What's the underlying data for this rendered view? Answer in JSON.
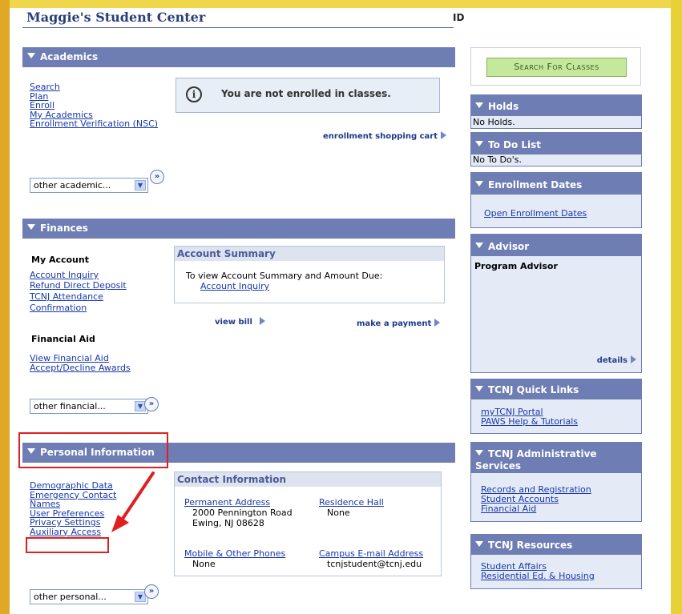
{
  "header": {
    "title": "Maggie's Student Center",
    "id_label": "ID"
  },
  "academics": {
    "header": "Academics",
    "links": [
      "Search",
      "Plan",
      "Enroll",
      "My Academics",
      "Enrollment Verification (NSC)"
    ],
    "notice": "You are not enrolled in classes.",
    "shopping_cart": "enrollment shopping cart",
    "dropdown": "other academic..."
  },
  "finances": {
    "header": "Finances",
    "my_account_heading": "My Account",
    "account_links": [
      "Account Inquiry",
      "Refund Direct Deposit",
      "TCNJ Attendance",
      "Confirmation"
    ],
    "financial_aid_heading": "Financial Aid",
    "aid_links": [
      "View Financial Aid",
      "Accept/Decline Awards"
    ],
    "summary_title": "Account Summary",
    "summary_text": "To view Account Summary and Amount Due:",
    "summary_link": "Account Inquiry",
    "view_bill": "view bill",
    "make_payment": "make a payment",
    "dropdown": "other financial..."
  },
  "personal": {
    "header": "Personal Information",
    "links": [
      "Demographic Data",
      "Emergency Contact",
      "Names",
      "User Preferences",
      "Privacy Settings",
      "Auxiliary Access"
    ],
    "contact_title": "Contact Information",
    "permanent_address_label": "Permanent Address",
    "address_line1": "2000 Pennington Road",
    "address_line2": "Ewing, NJ 08628",
    "residence_hall_label": "Residence Hall",
    "residence_hall_value": "None",
    "phones_label": "Mobile & Other Phones",
    "phones_value": "None",
    "email_label": "Campus E-mail Address",
    "email_value": "tcnjstudent@tcnj.edu",
    "dropdown": "other personal..."
  },
  "sidebar": {
    "search_button": "Search For Classes",
    "holds": {
      "header": "Holds",
      "text": "No Holds."
    },
    "todo": {
      "header": "To Do List",
      "text": "No To Do's."
    },
    "enrollment_dates": {
      "header": "Enrollment Dates",
      "link": "Open Enrollment Dates"
    },
    "advisor": {
      "header": "Advisor",
      "label": "Program Advisor",
      "details": "details"
    },
    "quick_links": {
      "header": "TCNJ Quick Links",
      "links": [
        "myTCNJ Portal",
        "PAWS Help & Tutorials"
      ]
    },
    "admin_services": {
      "header": "TCNJ Administrative Services",
      "links": [
        "Records and Registration",
        "Student Accounts",
        "Financial Aid"
      ]
    },
    "resources": {
      "header": "TCNJ Resources",
      "links": [
        "Student Affairs",
        "Residential Ed. & Housing"
      ]
    }
  },
  "colors": {
    "header_blue": "#6e7db3",
    "highlight_red": "#e02020",
    "frame_gold": "#e0a824",
    "link_blue": "#1838a8"
  }
}
